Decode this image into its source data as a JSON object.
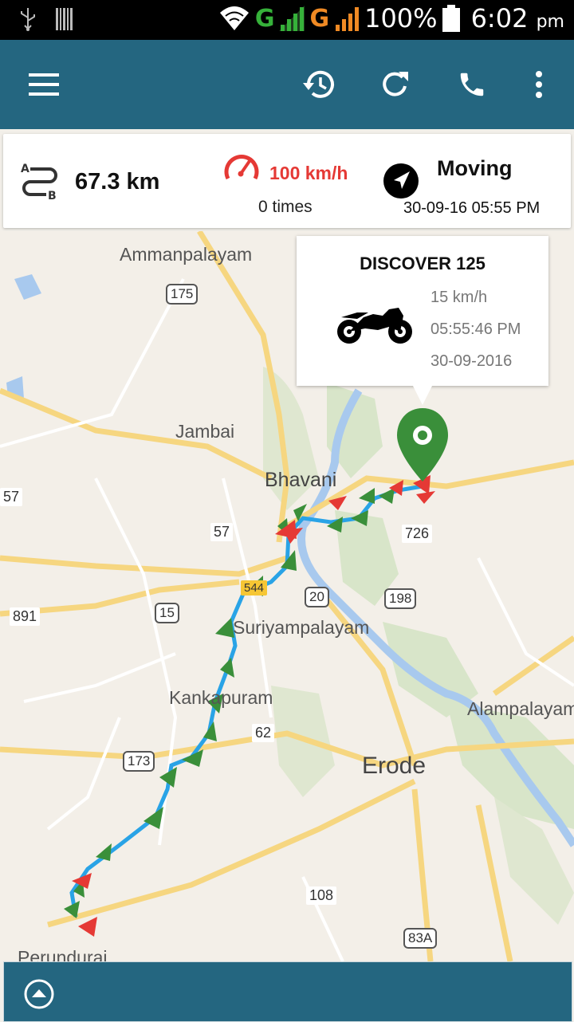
{
  "statusbar": {
    "signal1": "G",
    "signal2": "G",
    "battery": "100%",
    "time": "6:02",
    "ampm": "pm"
  },
  "toolbar": {
    "menu_icon": "hamburger-icon",
    "history_icon": "history-icon",
    "refresh_icon": "refresh-icon",
    "call_icon": "phone-icon",
    "more_icon": "more-vert-icon"
  },
  "stats": {
    "distance": "67.3 km",
    "speed_limit": "100 km/h",
    "overspeed_count": "0 times",
    "status": "Moving",
    "timestamp": "30-09-16 05:55 PM"
  },
  "info_window": {
    "title": "DISCOVER 125",
    "speed": "15 km/h",
    "time": "05:55:46 PM",
    "date": "30-09-2016"
  },
  "map": {
    "places": [
      "Ammanpalayam",
      "Jambai",
      "Bhavani",
      "Suriyampalayam",
      "Kankapuram",
      "Erode",
      "Alampalayam",
      "Perundurai"
    ],
    "roads": [
      "175",
      "57",
      "726",
      "20",
      "198",
      "15",
      "891",
      "62",
      "173",
      "108",
      "83A",
      "544",
      "57"
    ]
  },
  "colors": {
    "appbar": "#246680",
    "accent_red": "#e53935",
    "marker_green": "#3a8f3a",
    "route_blue": "#29a3e6"
  }
}
